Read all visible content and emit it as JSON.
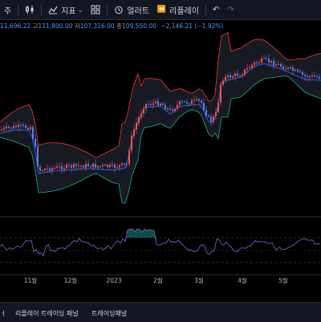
{
  "toolbar": {
    "interval_label": "주",
    "indicators_label": "지표",
    "alert_label": "얼러트",
    "replay_label": "리플레이"
  },
  "legend": {
    "open_prefix": "",
    "open_value": "11,696.22",
    "high_label": "고",
    "high_value": "111,800.00",
    "low_label": "저",
    "low_value": "107,316.00",
    "close_label": "종",
    "close_value": "109,550.00",
    "change": "−2,146.21 (−1.92%)"
  },
  "xaxis": {
    "labels": [
      "11월",
      "12월",
      "2023",
      "2월",
      "3월",
      "4월",
      "5월"
    ]
  },
  "bottom": {
    "item1": "리플레이 트레이딩 패널",
    "item2": "트레이딩패널"
  },
  "colors": {
    "bull": "#ef5350",
    "bear": "#5b7fe8",
    "basis": "#2962ff",
    "upper_band": "#f23645",
    "lower_band": "#22ab94",
    "rsi": "#7e57c2"
  }
}
